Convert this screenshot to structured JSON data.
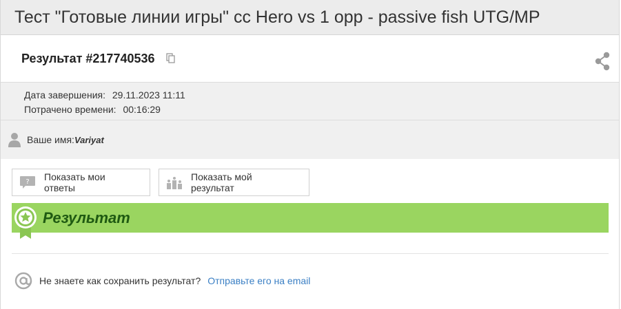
{
  "test_title": "Тест \"Готовые линии игры\" cc Hero vs 1 opp - passive fish UTG/MP",
  "result": {
    "title": "Результат #217740536"
  },
  "meta": {
    "completed_label": "Дата завершения:",
    "completed_value": "29.11.2023 11:11",
    "time_label": "Потрачено времени:",
    "time_value": "00:16:29"
  },
  "user": {
    "name_label": "Ваше имя:",
    "name_value": "Variyat"
  },
  "buttons": {
    "show_answers": "Показать мои ответы",
    "show_result": "Показать мой результат"
  },
  "banner": {
    "label": "Результат",
    "color": "#9ad560"
  },
  "email": {
    "question": "Не знаете как сохранить результат?",
    "link": "Отправьте его на email"
  },
  "icons": [
    "copy-icon",
    "share-icon",
    "user-icon",
    "question-bubble-icon",
    "podium-icon",
    "award-badge-icon",
    "at-icon"
  ]
}
